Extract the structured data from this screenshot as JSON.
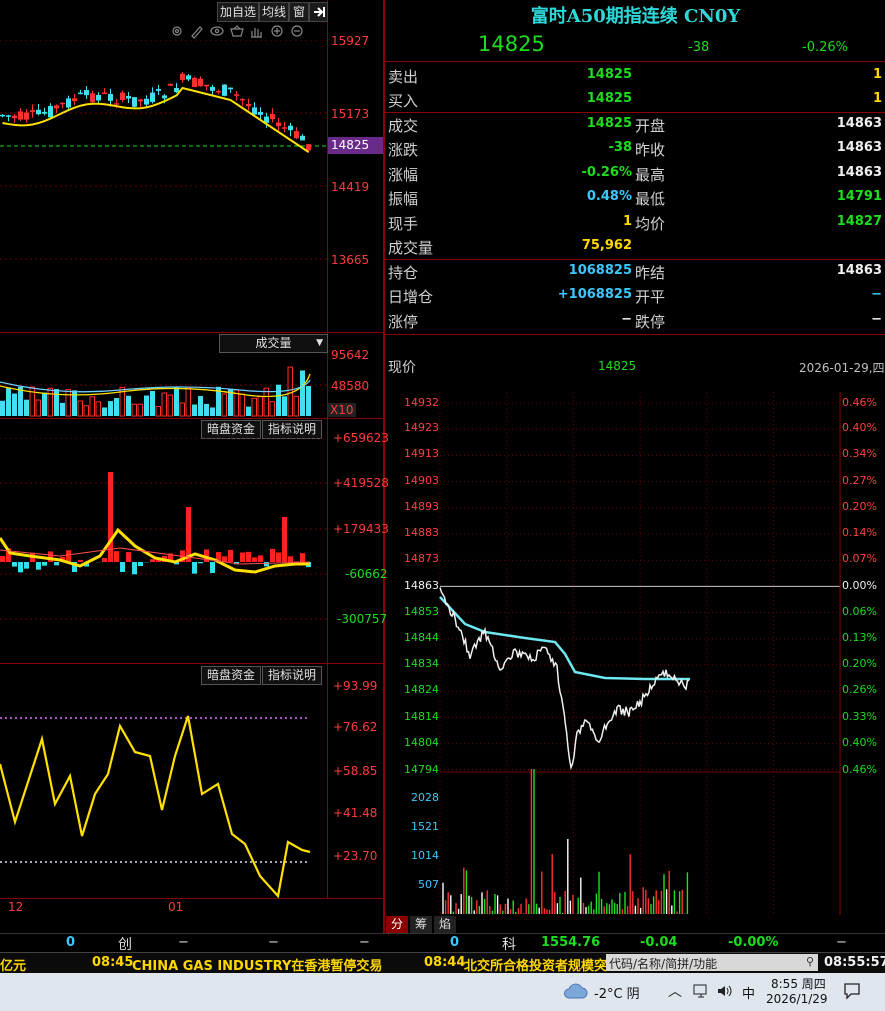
{
  "toolbar": {
    "tabs": [
      "加自选",
      "均线",
      "窗"
    ],
    "icons": [
      "settings-icon",
      "pen-icon",
      "eye-icon",
      "basket-icon",
      "hand-icon",
      "zoom-in-icon",
      "zoom-out-icon"
    ]
  },
  "kline": {
    "axis": [
      "15927",
      "15173",
      "14419",
      "13665"
    ],
    "current_price": "14825",
    "x_labels": [
      "12",
      "01"
    ]
  },
  "volume": {
    "dropdown": "成交量",
    "axis": [
      "95642",
      "48580"
    ],
    "unit": "X10"
  },
  "indicator1": {
    "buttons": [
      "暗盘资金",
      "指标说明"
    ],
    "axis": [
      "+659623",
      "+419528",
      "+179433",
      "-60662",
      "-300757"
    ]
  },
  "indicator2": {
    "buttons": [
      "暗盘资金",
      "指标说明"
    ],
    "axis": [
      "+93.99",
      "+76.62",
      "+58.85",
      "+41.48",
      "+23.70"
    ]
  },
  "quote": {
    "title": "富时A50期指连续 CN0Y",
    "price": "14825",
    "change": "-38",
    "change_pct": "-0.26%",
    "sell_label": "卖出",
    "sell_price": "14825",
    "sell_qty": "1",
    "buy_label": "买入",
    "buy_price": "14825",
    "buy_qty": "1",
    "rows": [
      {
        "l1": "成交",
        "v1": "14825",
        "l2": "开盘",
        "v2": "14863"
      },
      {
        "l1": "涨跌",
        "v1": "-38",
        "l2": "昨收",
        "v2": "14863"
      },
      {
        "l1": "涨幅",
        "v1": "-0.26%",
        "l2": "最高",
        "v2": "14863"
      },
      {
        "l1": "振幅",
        "v1": "0.48%",
        "l2": "最低",
        "v2": "14791"
      },
      {
        "l1": "现手",
        "v1": "1",
        "l2": "均价",
        "v2": "14827"
      },
      {
        "l1": "成交量",
        "v1": "75,962",
        "l2": "",
        "v2": ""
      },
      {
        "l1": "持仓",
        "v1": "1068825",
        "l2": "昨结",
        "v2": "14863"
      },
      {
        "l1": "日增仓",
        "v1": "+1068825",
        "l2": "开平",
        "v2": "−"
      },
      {
        "l1": "涨停",
        "v1": "−",
        "l2": "跌停",
        "v2": "−"
      }
    ]
  },
  "intraday": {
    "label": "现价",
    "price": "14825",
    "date": "2026-01-29,四",
    "left_axis": [
      "14932",
      "14923",
      "14913",
      "14903",
      "14893",
      "14883",
      "14873",
      "14863",
      "14853",
      "14844",
      "14834",
      "14824",
      "14814",
      "14804",
      "14794"
    ],
    "right_axis": [
      "0.46%",
      "0.40%",
      "0.34%",
      "0.27%",
      "0.20%",
      "0.14%",
      "0.07%",
      "0.00%",
      "0.06%",
      "0.13%",
      "0.20%",
      "0.26%",
      "0.33%",
      "0.40%",
      "0.46%"
    ],
    "vol_axis": [
      "2028",
      "1521",
      "1014",
      "507"
    ],
    "tabs": [
      "分",
      "筹",
      "焰"
    ]
  },
  "status": {
    "left_val": "0",
    "chuang": "创",
    "dash1": "−",
    "dash2": "−",
    "dash3": "−",
    "mid_val": "0",
    "ke": "科",
    "ke_val": "1554.76",
    "ke_chg": "-0.04",
    "ke_pct": "-0.00%",
    "ke_dash": "−"
  },
  "ticker": {
    "prefix": "亿元",
    "item1_time": "08:45",
    "item1_text": "CHINA GAS INDUSTRY在香港暂停交易",
    "item2_time": "08:44",
    "item2_text": "北交所合格投资者规模突",
    "search_placeholder": "代码/名称/简拼/功能",
    "clock": "08:55:57"
  },
  "taskbar": {
    "weather": "-2°C 阴",
    "ime": "中",
    "time": "8:55 周四",
    "date": "2026/1/29"
  }
}
